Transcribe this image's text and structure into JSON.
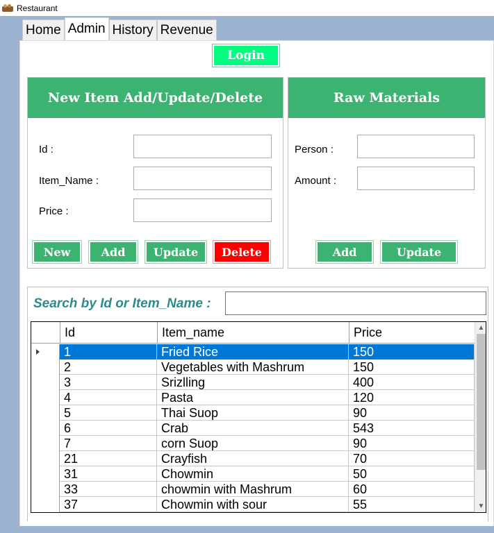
{
  "window": {
    "title": "Restaurant"
  },
  "tabs": [
    {
      "label": "Home",
      "active": false
    },
    {
      "label": "Admin",
      "active": true
    },
    {
      "label": "History",
      "active": false
    },
    {
      "label": "Revenue",
      "active": false
    }
  ],
  "login_label": "Login",
  "item_group": {
    "title": "New Item Add/Update/Delete",
    "fields": [
      {
        "label": "Id :",
        "value": ""
      },
      {
        "label": "Item_Name :",
        "value": ""
      },
      {
        "label": "Price :",
        "value": ""
      }
    ],
    "buttons": {
      "new": "New",
      "add": "Add",
      "update": "Update",
      "delete": "Delete"
    }
  },
  "raw_group": {
    "title": "Raw Materials",
    "fields": [
      {
        "label": "Person :",
        "value": ""
      },
      {
        "label": "Amount :",
        "value": ""
      }
    ],
    "buttons": {
      "add": "Add",
      "update": "Update"
    }
  },
  "search": {
    "label": "Search by Id or Item_Name :",
    "value": ""
  },
  "grid": {
    "columns": [
      "Id",
      "Item_name",
      "Price"
    ],
    "selected_row": 0,
    "rows": [
      [
        "1",
        "Fried Rice",
        "150"
      ],
      [
        "2",
        "Vegetables with Mashrum",
        "150"
      ],
      [
        "3",
        "Srizlling",
        "400"
      ],
      [
        "4",
        "Pasta",
        "120"
      ],
      [
        "5",
        "Thai Suop",
        "90"
      ],
      [
        "6",
        "Crab",
        "543"
      ],
      [
        "7",
        "corn Suop",
        "90"
      ],
      [
        "21",
        "Crayfish",
        "70"
      ],
      [
        "31",
        "Chowmin",
        "50"
      ],
      [
        "33",
        "chowmin with Mashrum",
        "60"
      ],
      [
        "37",
        "Chowmin with sour",
        "55"
      ]
    ]
  },
  "colors": {
    "accent_green": "#3cb371",
    "login_green": "#00ff80",
    "delete_red": "#ff0000",
    "selection_blue": "#0078d7",
    "search_label": "#2e8b8b"
  }
}
